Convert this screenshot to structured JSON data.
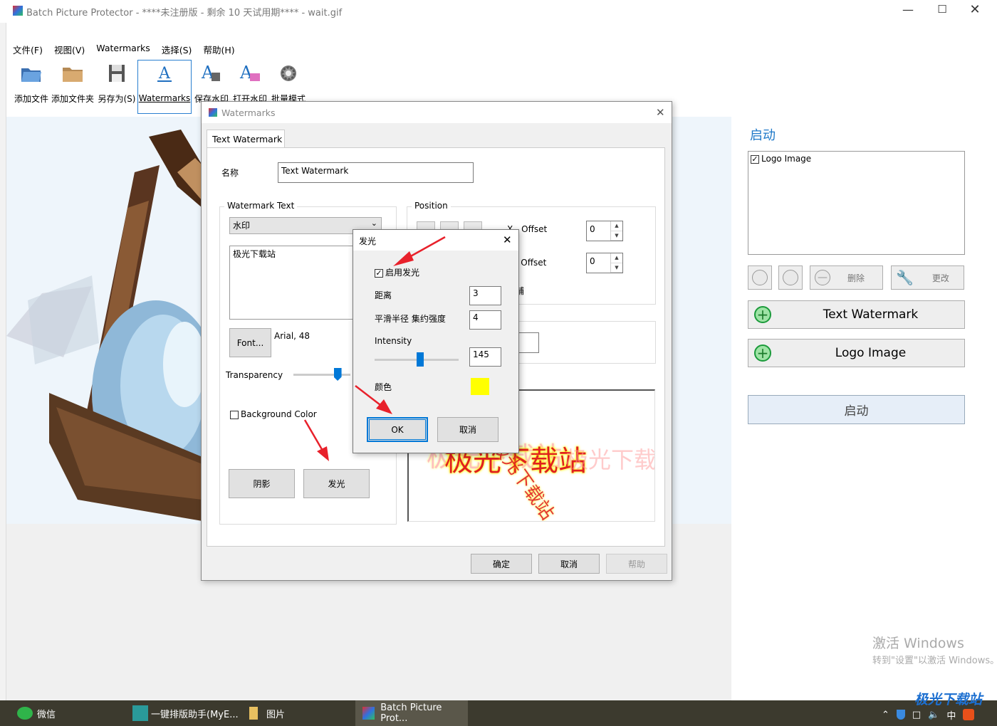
{
  "window": {
    "title": "Batch Picture Protector - ****未注册版 - 剩余 10 天试用期**** - wait.gif"
  },
  "menu": [
    "文件(F)",
    "视图(V)",
    "Watermarks",
    "选择(S)",
    "帮助(H)"
  ],
  "toolbar": [
    {
      "label": "添加文件",
      "icon": "open-folder-icon"
    },
    {
      "label": "添加文件夹",
      "icon": "folder-icon"
    },
    {
      "label": "另存为(S)",
      "icon": "floppy-disk-icon"
    },
    {
      "label": "Watermarks",
      "icon": "text-a-icon"
    },
    {
      "label": "保存水印",
      "icon": "save-watermark-icon"
    },
    {
      "label": "打开水印",
      "icon": "open-watermark-icon"
    },
    {
      "label": "批量模式",
      "icon": "gear-icon"
    }
  ],
  "right_panel": {
    "title": "启动",
    "list_items": [
      {
        "label": "Logo Image",
        "checked": true
      }
    ],
    "delete_label": "删除",
    "change_label": "更改",
    "add_text_label": "Text Watermark",
    "add_logo_label": "Logo Image",
    "start_label": "启动"
  },
  "watermarks_dialog": {
    "title": "Watermarks",
    "tab": "Text Watermark",
    "name_label": "名称",
    "name_value": "Text Watermark",
    "watermark_text_group": "Watermark Text",
    "text_type": "水印",
    "text_value": "极光下载站",
    "font_button": "Font...",
    "font_info": "Arial, 48",
    "transparency_label": "Transparency",
    "transparency_level": 0.82,
    "background_color_label": "Background Color",
    "background_color_checked": false,
    "shadow_button": "阴影",
    "glow_button": "发光",
    "position_group": "Position",
    "x_offset_label": "X - Offset",
    "x_offset_value": "0",
    "y_offset_label": "Y - Offset",
    "y_offset_value": "0",
    "tile_label": "平铺",
    "ok_button": "确定",
    "cancel_button": "取消",
    "help_button": "帮助"
  },
  "glow_dialog": {
    "title": "发光",
    "enable_label": "启用发光",
    "enable_checked": true,
    "distance_label": "距离",
    "distance_value": "3",
    "radius_label": "平滑半径 集约强度",
    "radius_value": "4",
    "intensity_label": "Intensity",
    "intensity_value": "145",
    "intensity_fraction": 0.55,
    "color_label": "颜色",
    "color_value": "#ffff00",
    "ok_label": "OK",
    "cancel_label": "取消"
  },
  "preview_text": "极光下载站",
  "activation": {
    "line1": "激活 Windows",
    "line2": "转到\"设置\"以激活 Windows。"
  },
  "taskbar": [
    {
      "label": "微信",
      "icon": "wechat-icon"
    },
    {
      "label": "一键排版助手(MyE...",
      "icon": "typeset-icon"
    },
    {
      "label": "图片",
      "icon": "folder-icon"
    },
    {
      "label": "Batch Picture Prot...",
      "icon": "app-icon"
    }
  ],
  "tray": {
    "ime": "中",
    "logo_text": "极光下载站"
  },
  "colors": {
    "accent": "#0078d7",
    "glow": "#ffff00",
    "arrow": "#e8212b",
    "watermark_red": "#e02020"
  }
}
